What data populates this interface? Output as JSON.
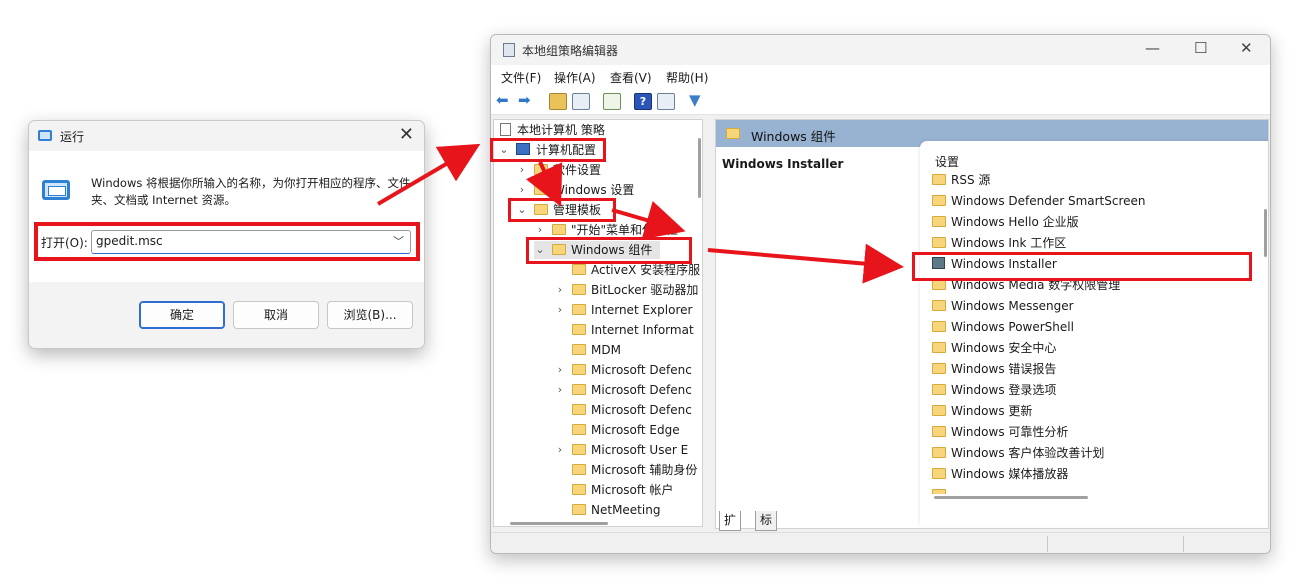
{
  "run_dialog": {
    "title": "运行",
    "close_glyph": "✕",
    "description": "Windows 将根据你所输入的名称，为你打开相应的程序、文件夹、文档或 Internet 资源。",
    "open_label": "打开(O):",
    "open_value": "gpedit.msc",
    "dropdown_glyph": "﹀",
    "ok": "确定",
    "cancel": "取消",
    "browse": "浏览(B)..."
  },
  "gpedit": {
    "title": "本地组策略编辑器",
    "window_controls": {
      "minimize": "—",
      "maximize": "☐",
      "close": "✕"
    },
    "menus": [
      "文件(F)",
      "操作(A)",
      "查看(V)",
      "帮助(H)"
    ],
    "tree": [
      {
        "label": "本地计算机 策略"
      },
      {
        "label": "计算机配置"
      },
      {
        "label": "软件设置"
      },
      {
        "label": "Windows 设置"
      },
      {
        "label": "管理模板"
      },
      {
        "label": "\"开始\"菜单和任务栏"
      },
      {
        "label": "Windows 组件"
      },
      {
        "label": "ActiveX 安装程序服"
      },
      {
        "label": "BitLocker 驱动器加"
      },
      {
        "label": "Internet Explorer"
      },
      {
        "label": "Internet Informat"
      },
      {
        "label": "MDM"
      },
      {
        "label": "Microsoft Defenc"
      },
      {
        "label": "Microsoft Defenc"
      },
      {
        "label": "Microsoft Defenc"
      },
      {
        "label": "Microsoft Edge"
      },
      {
        "label": "Microsoft User E"
      },
      {
        "label": "Microsoft 辅助身份"
      },
      {
        "label": "Microsoft 帐户"
      },
      {
        "label": "NetMeeting"
      }
    ],
    "right_header": "Windows 组件",
    "selected_name": "Windows Installer",
    "list_title": "设置",
    "list_items": [
      "RSS 源",
      "Windows Defender SmartScreen",
      "Windows Hello 企业版",
      "Windows Ink 工作区",
      "Windows Installer",
      "Windows Media 数字权限管理",
      "Windows Messenger",
      "Windows PowerShell",
      "Windows 安全中心",
      "Windows 错误报告",
      "Windows 登录选项",
      "Windows 更新",
      "Windows 可靠性分析",
      "Windows 客户体验改善计划",
      "Windows 媒体播放器"
    ],
    "tabs": [
      "扩展",
      "标准"
    ],
    "chevrons": {
      "open": "⌄",
      "closed": "›"
    },
    "highlight_color": "#e8141b",
    "header_color": "#98b3d2"
  }
}
